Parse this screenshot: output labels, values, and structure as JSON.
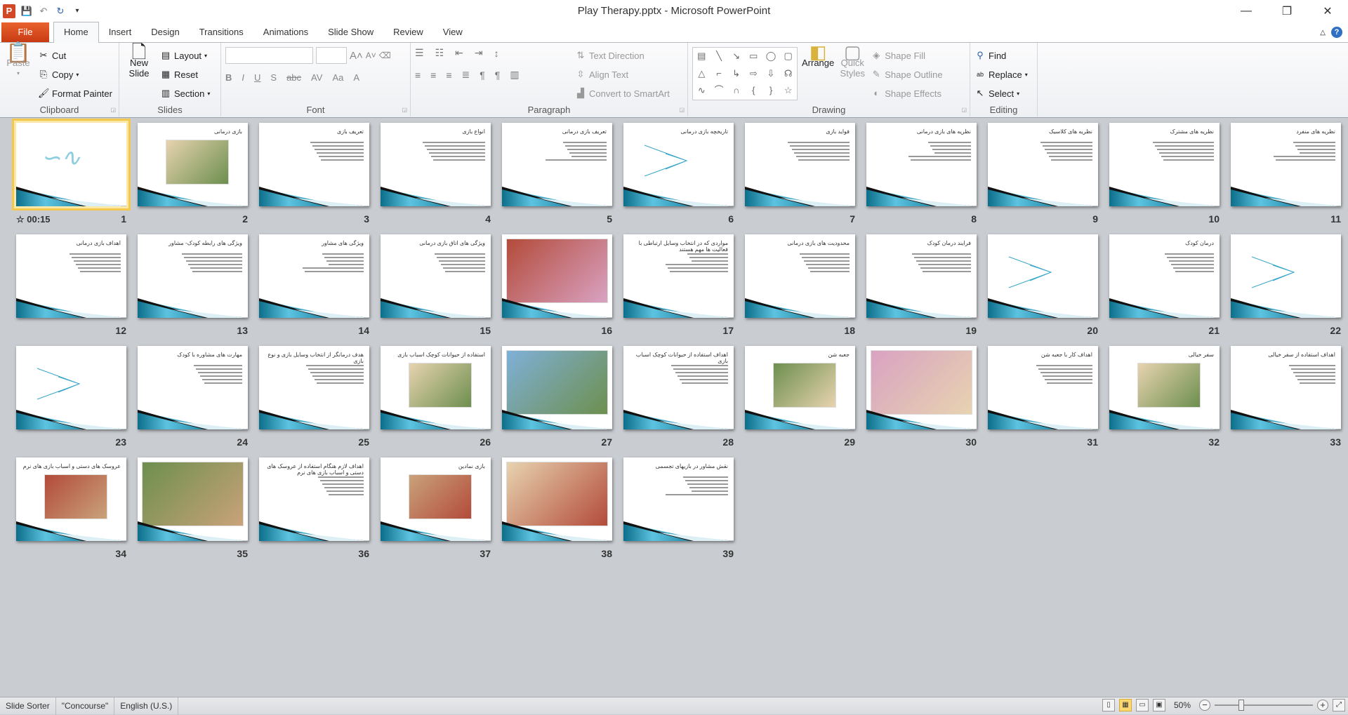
{
  "window": {
    "title": "Play Therapy.pptx - Microsoft PowerPoint",
    "app_icon": "P"
  },
  "tabs": [
    {
      "label": "File"
    },
    {
      "label": "Home"
    },
    {
      "label": "Insert"
    },
    {
      "label": "Design"
    },
    {
      "label": "Transitions"
    },
    {
      "label": "Animations"
    },
    {
      "label": "Slide Show"
    },
    {
      "label": "Review"
    },
    {
      "label": "View"
    }
  ],
  "active_tab": "Home",
  "ribbon": {
    "clipboard": {
      "label": "Clipboard",
      "paste": "Paste",
      "cut": "Cut",
      "copy": "Copy",
      "format_painter": "Format Painter"
    },
    "slides": {
      "label": "Slides",
      "new_slide": "New Slide",
      "layout": "Layout",
      "reset": "Reset",
      "section": "Section"
    },
    "font": {
      "label": "Font",
      "font_name": "",
      "font_size": ""
    },
    "paragraph": {
      "label": "Paragraph",
      "text_direction": "Text Direction",
      "align_text": "Align Text",
      "convert_smartart": "Convert to SmartArt"
    },
    "drawing": {
      "label": "Drawing",
      "arrange": "Arrange",
      "quick_styles": "Quick Styles",
      "shape_fill": "Shape Fill",
      "shape_outline": "Shape Outline",
      "shape_effects": "Shape Effects"
    },
    "editing": {
      "label": "Editing",
      "find": "Find",
      "replace": "Replace",
      "select": "Select"
    }
  },
  "slides": [
    {
      "num": "1",
      "title": "",
      "type": "calligraphy",
      "timing": "00:15",
      "selected": true
    },
    {
      "num": "2",
      "title": "بازی درمانی",
      "type": "image"
    },
    {
      "num": "3",
      "title": "تعریف بازی",
      "type": "text"
    },
    {
      "num": "4",
      "title": "انواع بازی",
      "type": "text"
    },
    {
      "num": "5",
      "title": "تعریف بازی درمانی",
      "type": "text"
    },
    {
      "num": "6",
      "title": "تاریخچه بازی درمانی",
      "type": "diagram"
    },
    {
      "num": "7",
      "title": "فواید بازی",
      "type": "text"
    },
    {
      "num": "8",
      "title": "نظریه های بازی درمانی",
      "type": "text"
    },
    {
      "num": "9",
      "title": "نظریه های کلاسیک",
      "type": "text"
    },
    {
      "num": "10",
      "title": "نظریه های مشترک",
      "type": "text"
    },
    {
      "num": "11",
      "title": "نظریه های منفرد",
      "type": "text"
    },
    {
      "num": "12",
      "title": "اهداف بازی درمانی",
      "type": "text"
    },
    {
      "num": "13",
      "title": "ویژگی های رابطه کودک- مشاور",
      "type": "text"
    },
    {
      "num": "14",
      "title": "ویژگی های مشاور",
      "type": "text"
    },
    {
      "num": "15",
      "title": "ویژگی های اتاق بازی درمانی",
      "type": "text"
    },
    {
      "num": "16",
      "title": "",
      "type": "fullimage"
    },
    {
      "num": "17",
      "title": "مواردی که در انتخاب وسایل ارتباطی با فعالیت ها مهم هستند",
      "type": "text"
    },
    {
      "num": "18",
      "title": "محدودیت های بازی درمانی",
      "type": "text"
    },
    {
      "num": "19",
      "title": "فرایند درمان کودک",
      "type": "text"
    },
    {
      "num": "20",
      "title": "",
      "type": "diagram"
    },
    {
      "num": "21",
      "title": "درمان کودک",
      "type": "text"
    },
    {
      "num": "22",
      "title": "",
      "type": "diagram"
    },
    {
      "num": "23",
      "title": "",
      "type": "diagram"
    },
    {
      "num": "24",
      "title": "مهارت های مشاوره با کودک",
      "type": "text"
    },
    {
      "num": "25",
      "title": "هدف درمانگر از انتخاب وسایل بازی و نوع بازی",
      "type": "text"
    },
    {
      "num": "26",
      "title": "استفاده از حیوانات کوچک اسباب بازی",
      "type": "image"
    },
    {
      "num": "27",
      "title": "",
      "type": "fullimage"
    },
    {
      "num": "28",
      "title": "اهداف استفاده از حیوانات کوچک اسباب بازی",
      "type": "text"
    },
    {
      "num": "29",
      "title": "جعبه شن",
      "type": "image"
    },
    {
      "num": "30",
      "title": "",
      "type": "fullimage"
    },
    {
      "num": "31",
      "title": "اهداف کار با جعبه شن",
      "type": "text"
    },
    {
      "num": "32",
      "title": "سفر خیالی",
      "type": "image"
    },
    {
      "num": "33",
      "title": "اهداف استفاده از سفر خیالی",
      "type": "text"
    },
    {
      "num": "34",
      "title": "عروسک های دستی و اسباب بازی های نرم",
      "type": "image"
    },
    {
      "num": "35",
      "title": "",
      "type": "fullimage"
    },
    {
      "num": "36",
      "title": "اهداف لازم هنگام استفاده از عروسک های دستی و اسباب بازی های نرم",
      "type": "text"
    },
    {
      "num": "37",
      "title": "بازی نمادین",
      "type": "image"
    },
    {
      "num": "38",
      "title": "",
      "type": "fullimage"
    },
    {
      "num": "39",
      "title": "نقش مشاور در بازیهای تجسمی",
      "type": "text"
    }
  ],
  "status": {
    "view": "Slide Sorter",
    "theme": "\"Concourse\"",
    "language": "English (U.S.)",
    "zoom": "50%",
    "zoom_percent": 50
  },
  "colors": {
    "file_tab": "#d24726",
    "theme_teal": "#1d8aa8",
    "selection": "#f3c84c"
  }
}
